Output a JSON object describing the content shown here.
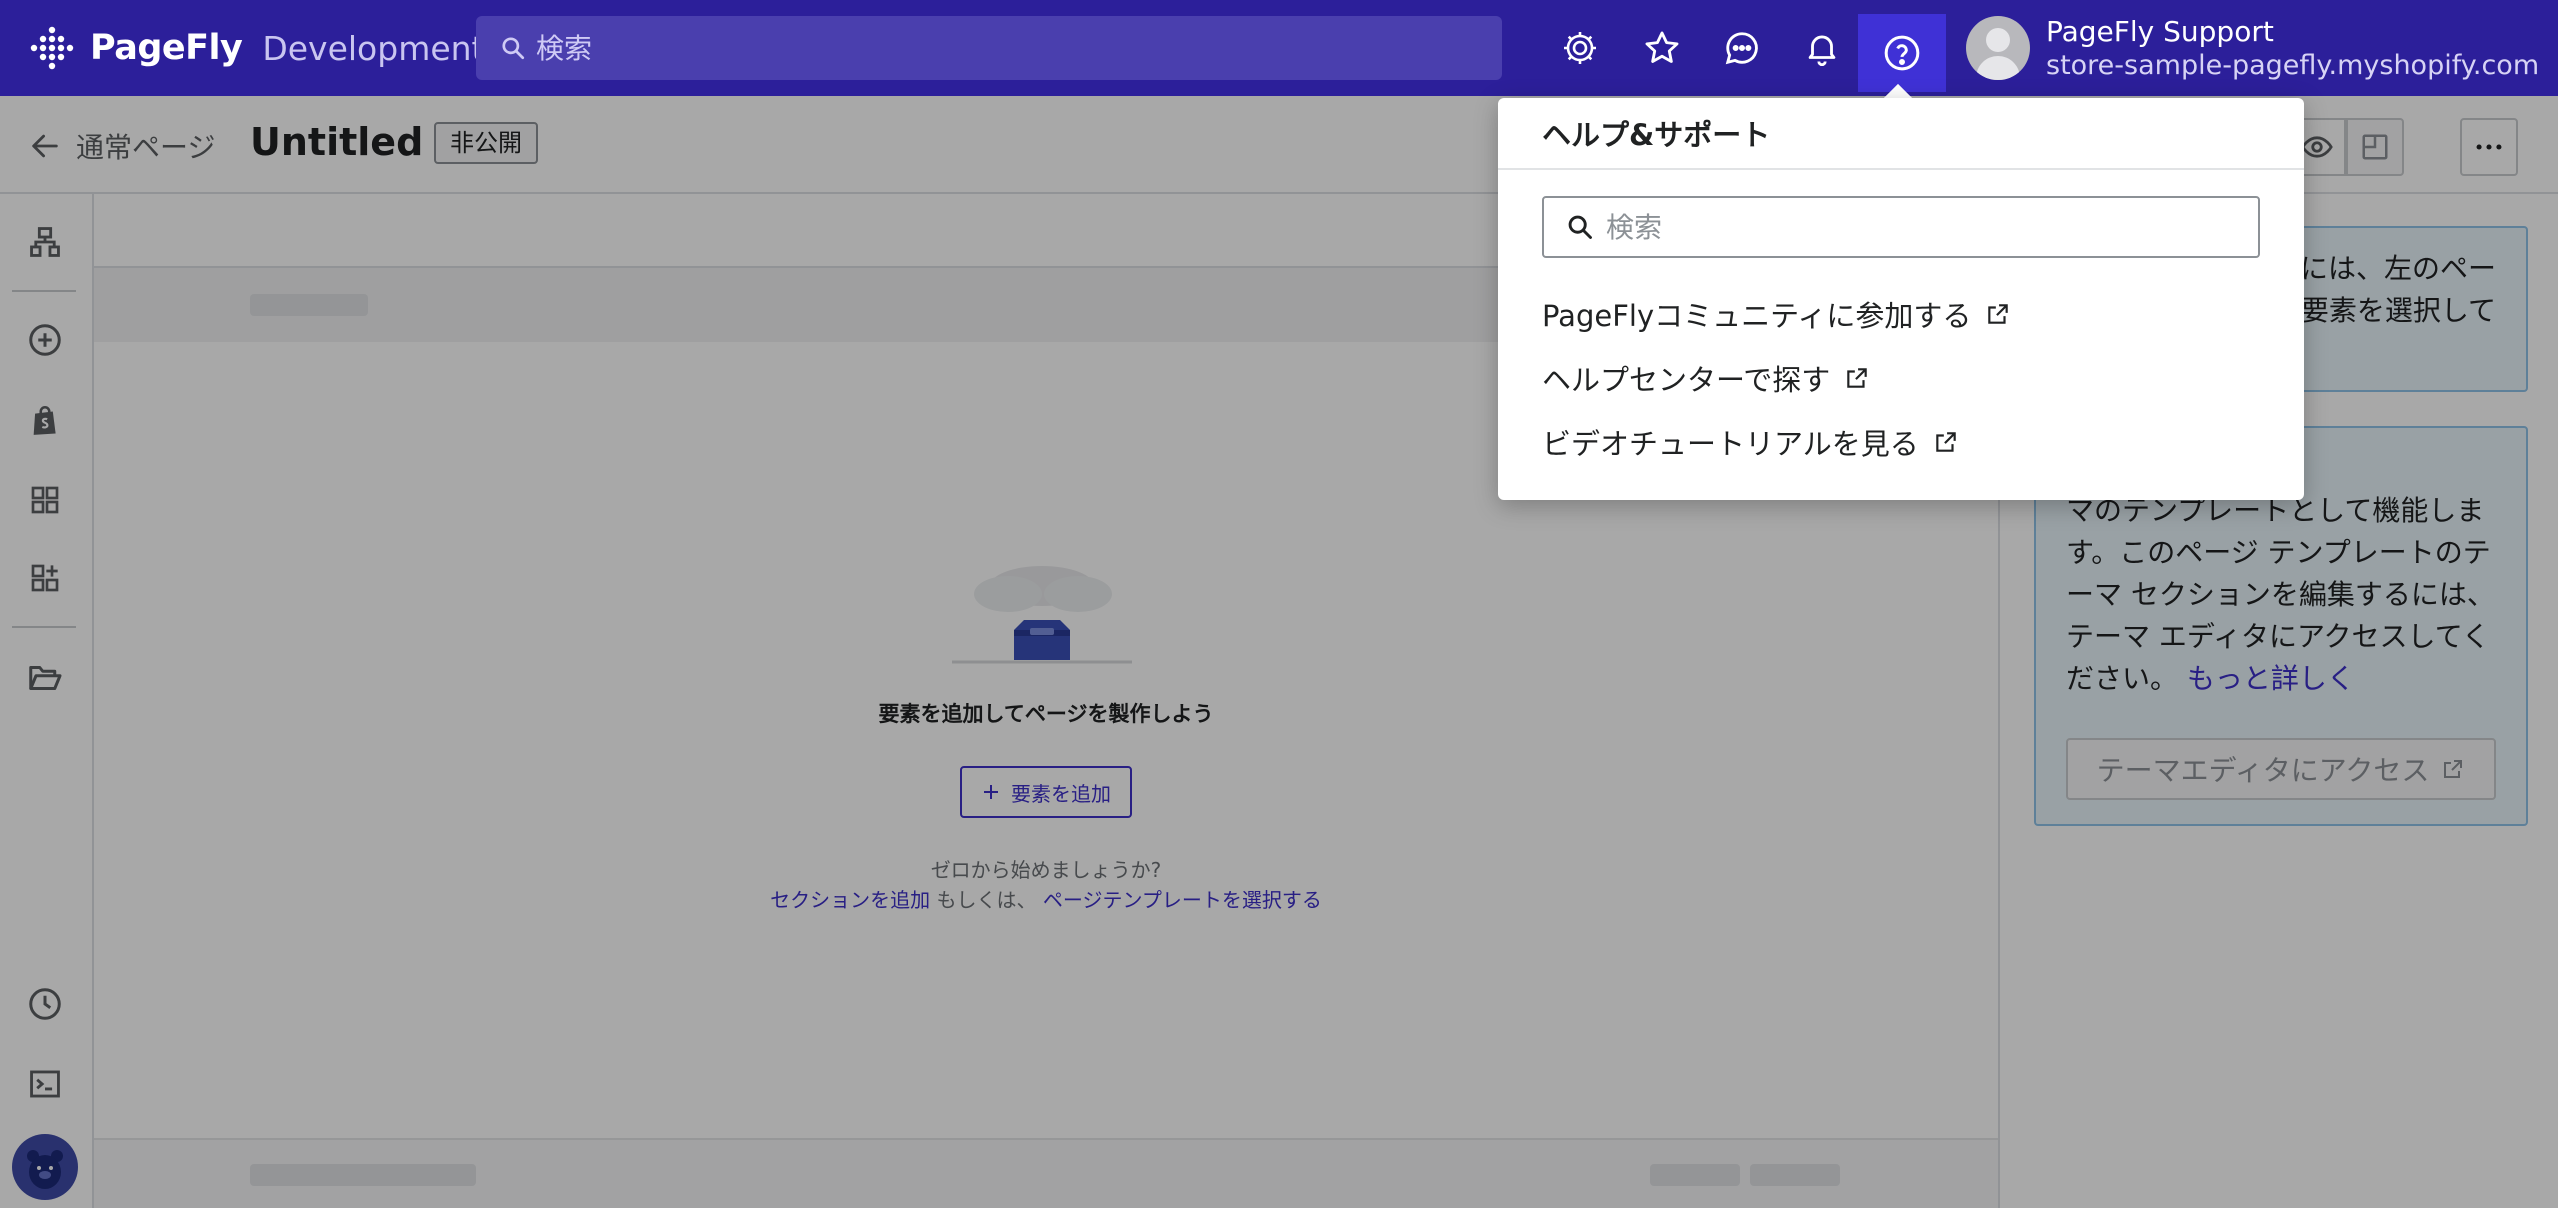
{
  "app": {
    "brand": "PageFly",
    "environment": "Development",
    "search_placeholder": "検索"
  },
  "account": {
    "name": "PageFly Support",
    "store": "store-sample-pagefly.myshopify.com"
  },
  "header": {
    "back_label": "通常ページ",
    "page_title": "Untitled",
    "status": "非公開"
  },
  "canvas": {
    "empty_message": "要素を追加してページを製作しよう",
    "add_element": "要素を追加",
    "start_question": "ゼロから始めましょうか?",
    "add_section": "セクションを追加",
    "or_text": " もしくは、 ",
    "choose_template": "ページテンプレートを選択する"
  },
  "right_panel": {
    "card1_text": "には、左のペー\n要素を選択して",
    "card2_text": "Shopify テー\nマのテンプレートとして機能しま\nす。このページ テンプレートのテ\nーマ セクションを編集するには、\nテーマ エディタにアクセスしてく\nださい。",
    "learn_more": "もっと詳しく",
    "theme_editor_button": "テーマエディタにアクセス"
  },
  "help_popover": {
    "title": "ヘルプ&サポート",
    "search_placeholder": "検索",
    "links": [
      {
        "label": "PageFlyコミュニティに参加する"
      },
      {
        "label": "ヘルプセンターで探す"
      },
      {
        "label": "ビデオチュートリアルを見る"
      }
    ]
  },
  "colors": {
    "topbar": "#2c1f9a",
    "accent": "#3d2fc9",
    "active_icon_bg": "#3f31d6"
  }
}
